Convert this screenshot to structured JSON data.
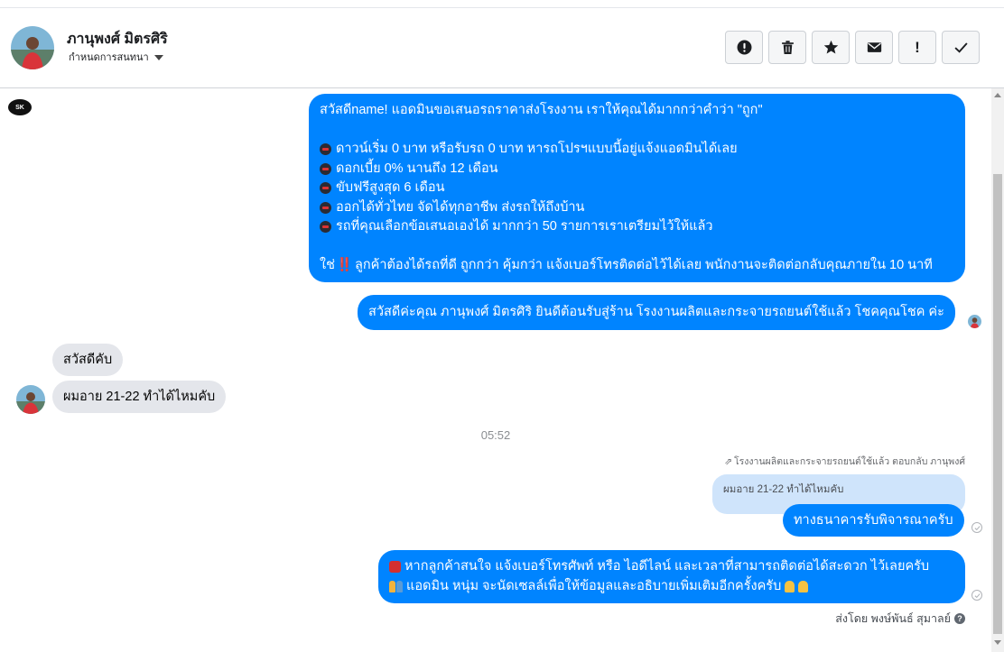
{
  "header": {
    "contact_name": "ภานุพงศ์ มิตรศิริ",
    "conversation_label": "กำหนดการสนทนา",
    "actions": [
      {
        "icon": "exclamation-circle-icon"
      },
      {
        "icon": "trash-icon"
      },
      {
        "icon": "star-icon"
      },
      {
        "icon": "envelope-icon"
      },
      {
        "icon": "exclamation-icon",
        "text": "!"
      },
      {
        "icon": "checkmark-icon"
      }
    ]
  },
  "thread": {
    "page_avatar_text": "SK",
    "outgoing_promo": {
      "greeting": "สวัสดีname! แอดมินขอเสนอรถราคาส่งโรงงาน เราให้คุณได้มากกว่าคำว่า \"ถูก\"",
      "bullets": [
        "ดาวน์เริ่ม 0 บาท หรือรับรถ 0 บาท หารถโปรฯแบบนี้อยู่แจ้งแอดมินได้เลย",
        "ดอกเบี้ย 0% นานถึง 12 เดือน",
        "ขับฟรีสูงสุด 6 เดือน",
        "ออกได้ทั่วไทย จัดได้ทุกอาชีพ ส่งรถให้ถึงบ้าน",
        "รถที่คุณเลือกข้อเสนอเองได้ มากกว่า 50 รายการเราเตรียมไว้ให้แล้ว"
      ],
      "closing_prefix": "ใช่",
      "closing_emoji": "‼️",
      "closing_text": "ลูกค้าต้องได้รถที่ดี ถูกกว่า คุ้มกว่า แจ้งเบอร์โทรติดต่อไว้ได้เลย พนักงานจะติดต่อกลับคุณภายใน 10 นาที"
    },
    "outgoing_welcome": "สวัสดีค่ะคุณ ภานุพงศ์ มิตรศิริ ยินดีต้อนรับสู่ร้าน โรงงานผลิตและกระจายรถยนต์ใช้แล้ว โชคคุณโชค ค่ะ",
    "incoming": [
      "สวัสดีคับ",
      "ผมอาย 21-22 ทำได้ไหมคับ"
    ],
    "timestamp": "05:52",
    "reply_meta": "โรงงานผลิตและกระจายรถยนต์ใช้แล้ว ตอบกลับ ภานุพงศ์",
    "quoted_text": "ผมอาย 21-22 ทำได้ไหมคับ",
    "outgoing_reply": "ทางธนาคารรับพิจารณาครับ",
    "outgoing_contact": {
      "line1": "หากลูกค้าสนใจ แจ้งเบอร์โทรศัพท์ หรือ ไอดีไลน์ และเวลาที่สามารถติดต่อได้สะดวก ไว้เลยครับ",
      "line2": "แอดมิน หนุ่ม จะนัดเซลล์เพื่อให้ข้อมูลและอธิบายเพิ่มเติมอีกครั้งครับ"
    },
    "sent_by": "ส่งโดย พงษ์พันธ์ สุมาลย์",
    "help": "?"
  },
  "colors": {
    "outgoing_bubble": "#0084ff",
    "incoming_bubble": "#e4e6eb",
    "quote_bubble": "#cfe4fb"
  }
}
